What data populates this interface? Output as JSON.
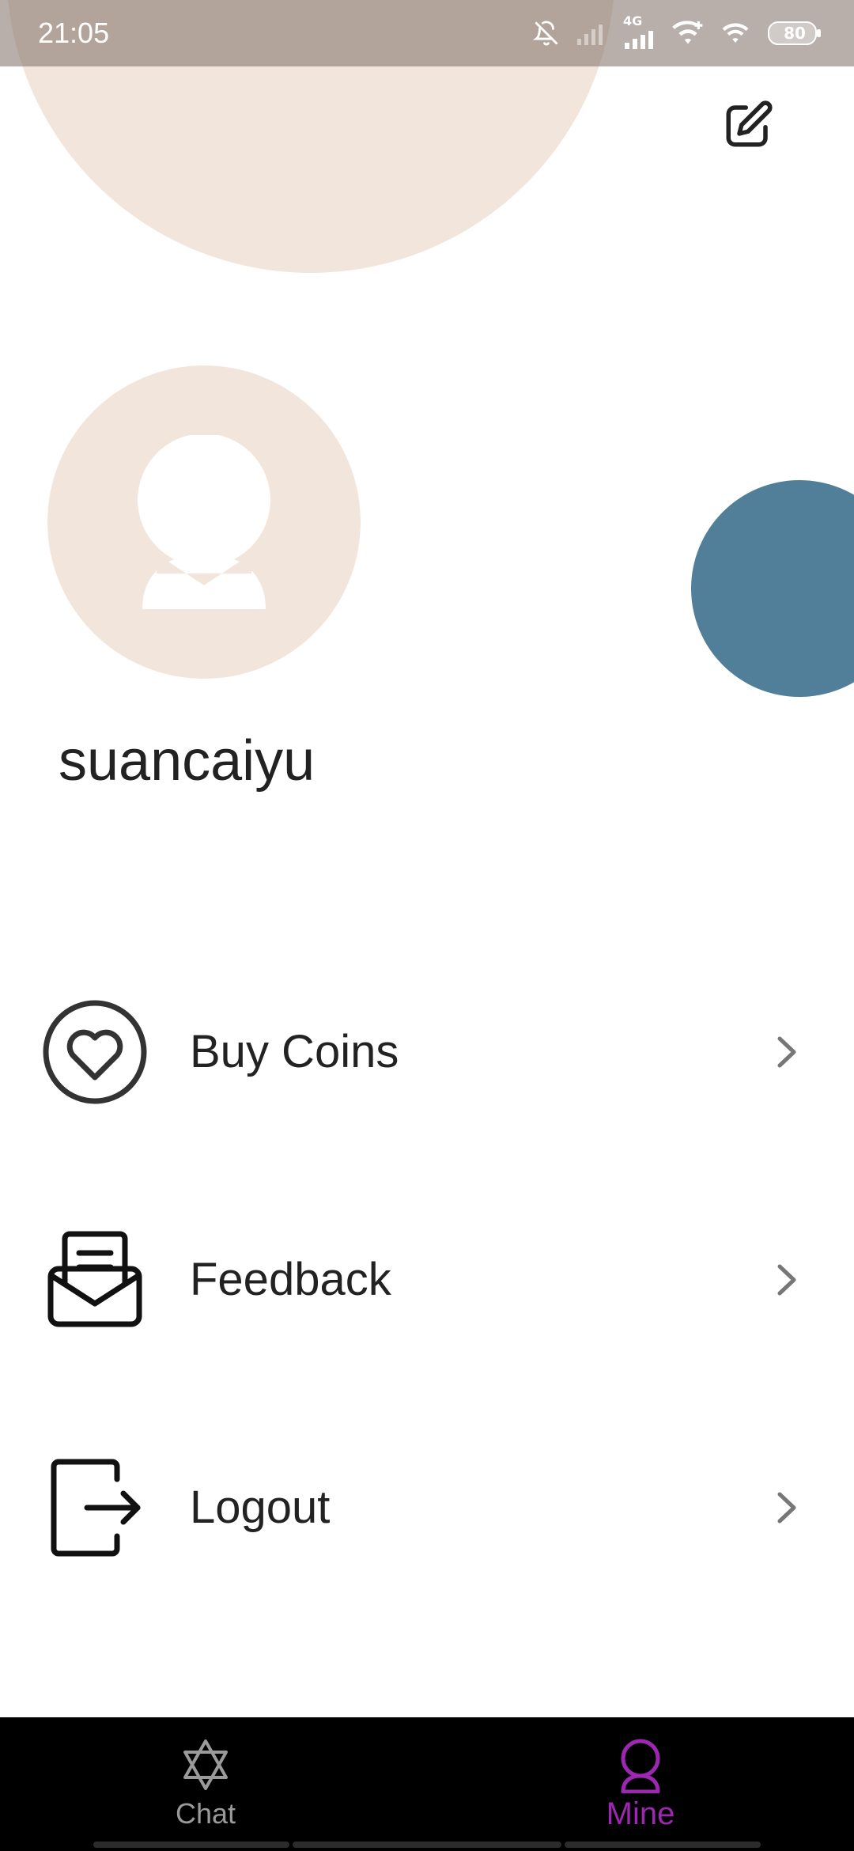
{
  "status_bar": {
    "time": "21:05",
    "network": "4G",
    "battery": "80",
    "icons": [
      "bell-off-icon",
      "signal-icon",
      "signal-4g-icon",
      "wifi-plus-icon",
      "wifi-icon",
      "battery-icon"
    ]
  },
  "profile": {
    "username": "suancaiyu",
    "edit_icon": "edit-icon",
    "avatar_icon": "person-icon"
  },
  "menu": {
    "items": [
      {
        "label": "Buy Coins",
        "icon": "heart-circle-icon"
      },
      {
        "label": "Feedback",
        "icon": "mail-open-icon"
      },
      {
        "label": "Logout",
        "icon": "logout-icon"
      }
    ]
  },
  "bottom_nav": {
    "tabs": [
      {
        "label": "Chat",
        "icon": "star-of-david-icon",
        "active": false
      },
      {
        "label": "Mine",
        "icon": "person-icon",
        "active": true
      }
    ]
  },
  "colors": {
    "accent": "#9c27b0",
    "avatar_bg": "#f2e6dc",
    "deco_blue": "#517f99",
    "nav_bg": "#000000",
    "text": "#222222"
  }
}
